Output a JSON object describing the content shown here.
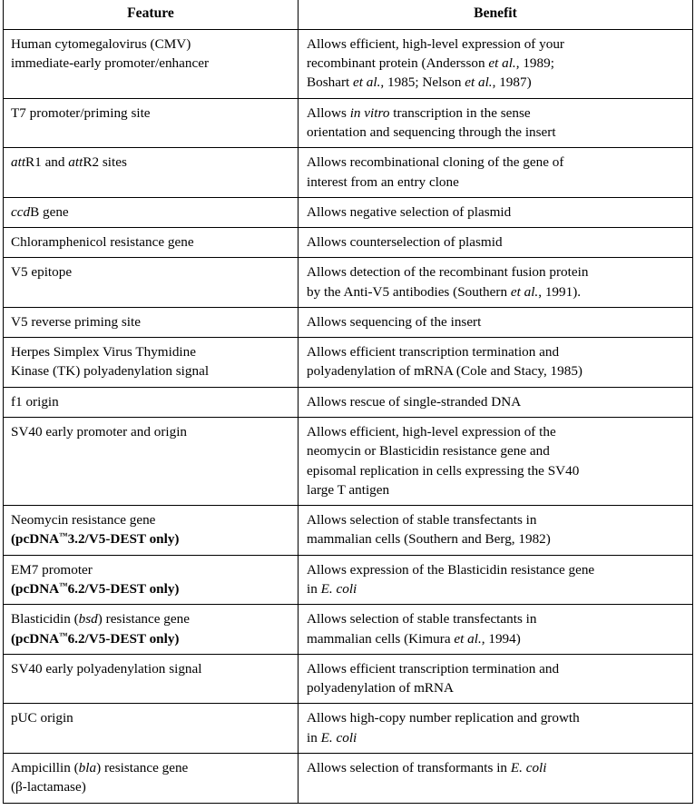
{
  "table": {
    "headers": {
      "feature": "Feature",
      "benefit": "Benefit"
    },
    "rows": [
      {
        "feature": "Human cytomegalovirus (CMV) immediate-early promoter/enhancer",
        "benefit": "Allows efficient, high-level expression of your recombinant protein (Andersson et al., 1989; Boshart et al., 1985; Nelson et al., 1987)"
      },
      {
        "feature": "T7 promoter/priming site",
        "benefit": "Allows in vitro transcription in the sense orientation and sequencing through the insert"
      },
      {
        "feature": "attR1 and attR2 sites",
        "benefit": "Allows recombinational cloning of the gene of interest from an entry clone"
      },
      {
        "feature": "ccdB gene",
        "benefit": "Allows negative selection of plasmid"
      },
      {
        "feature": "Chloramphenicol resistance gene",
        "benefit": "Allows counterselection of plasmid"
      },
      {
        "feature": "V5 epitope",
        "benefit": "Allows detection of the recombinant fusion protein by the Anti-V5 antibodies (Southern et al., 1991)."
      },
      {
        "feature": "V5 reverse priming site",
        "benefit": "Allows sequencing of the insert"
      },
      {
        "feature": "Herpes Simplex Virus Thymidine Kinase (TK) polyadenylation signal",
        "benefit": "Allows efficient transcription termination and polyadenylation of mRNA (Cole and Stacy, 1985)"
      },
      {
        "feature": "f1 origin",
        "benefit": "Allows rescue of single-stranded DNA"
      },
      {
        "feature": "SV40 early promoter and origin",
        "benefit": "Allows efficient, high-level expression of the neomycin or Blasticidin resistance gene and episomal replication in cells expressing the SV40 large T antigen"
      },
      {
        "feature": "Neomycin resistance gene (pcDNA™3.2/V5-DEST only)",
        "benefit": "Allows selection of stable transfectants in mammalian cells (Southern and Berg, 1982)"
      },
      {
        "feature": "EM7 promoter (pcDNA™6.2/V5-DEST only)",
        "benefit": "Allows expression of the Blasticidin resistance gene in E. coli"
      },
      {
        "feature": "Blasticidin (bsd) resistance gene (pcDNA™6.2/V5-DEST only)",
        "benefit": "Allows selection of stable transfectants in mammalian cells (Kimura et al., 1994)"
      },
      {
        "feature": "SV40 early polyadenylation signal",
        "benefit": "Allows efficient transcription termination and polyadenylation of mRNA"
      },
      {
        "feature": "pUC origin",
        "benefit": "Allows high-copy number replication and growth in E. coli"
      },
      {
        "feature": "Ampicillin (bla) resistance gene (β-lactamase)",
        "benefit": "Allows selection of transformants in E. coli"
      }
    ]
  }
}
